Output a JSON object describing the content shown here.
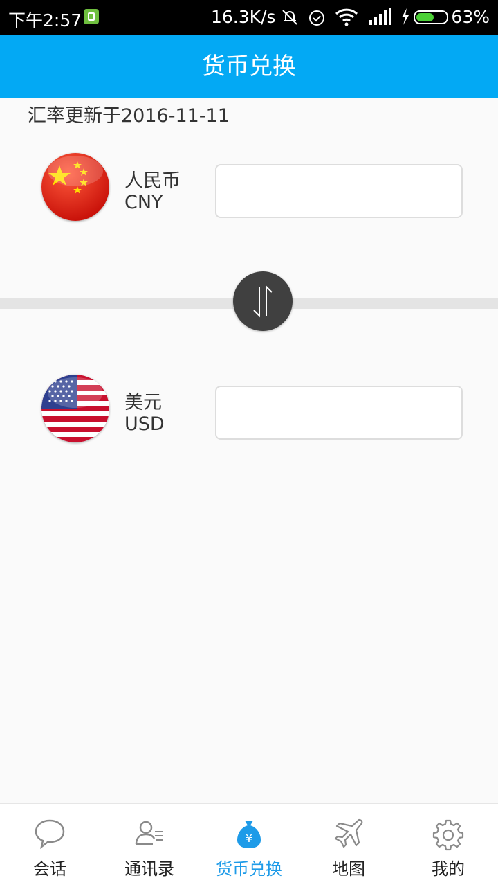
{
  "status_bar": {
    "time": "下午2:57",
    "net_speed": "16.3K/s",
    "battery_pct": "63%",
    "battery_level": 0.63,
    "icons": [
      "app-notification-icon",
      "mute-icon",
      "alarm-icon",
      "wifi-icon",
      "signal-icon",
      "charging-icon",
      "battery-icon"
    ]
  },
  "header": {
    "title": "货币兑换"
  },
  "rate_note": "汇率更新于2016-11-11",
  "from_currency": {
    "name": "人民币",
    "code": "CNY",
    "value": ""
  },
  "to_currency": {
    "name": "美元",
    "code": "USD",
    "value": ""
  },
  "swap": {
    "icon": "swap-arrows-icon"
  },
  "bottom_nav": {
    "items": [
      {
        "label": "会话",
        "icon": "chat-bubble-icon"
      },
      {
        "label": "通讯录",
        "icon": "contacts-icon"
      },
      {
        "label": "货币兑换",
        "icon": "money-bag-icon"
      },
      {
        "label": "地图",
        "icon": "airplane-icon"
      },
      {
        "label": "我的",
        "icon": "gear-icon"
      }
    ],
    "active_index": 2
  },
  "colors": {
    "header": "#03a9f4",
    "active_nav": "#1e9be8",
    "swap_button": "#404040"
  }
}
